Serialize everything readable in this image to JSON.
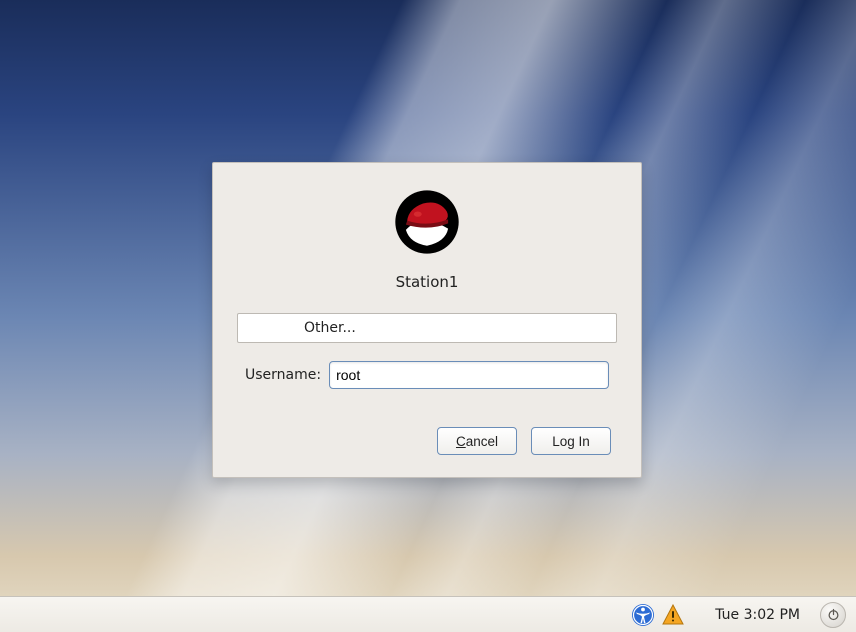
{
  "hostname": "Station1",
  "user_list": {
    "selected_label": "Other..."
  },
  "field": {
    "label": "Username:",
    "value": "root"
  },
  "buttons": {
    "cancel_prefix": "C",
    "cancel_rest": "ancel",
    "login": "Log In"
  },
  "panel": {
    "clock": "Tue  3:02 PM"
  },
  "colors": {
    "panel_bg": "#eeebe7",
    "accent_border": "#6a8db8"
  }
}
